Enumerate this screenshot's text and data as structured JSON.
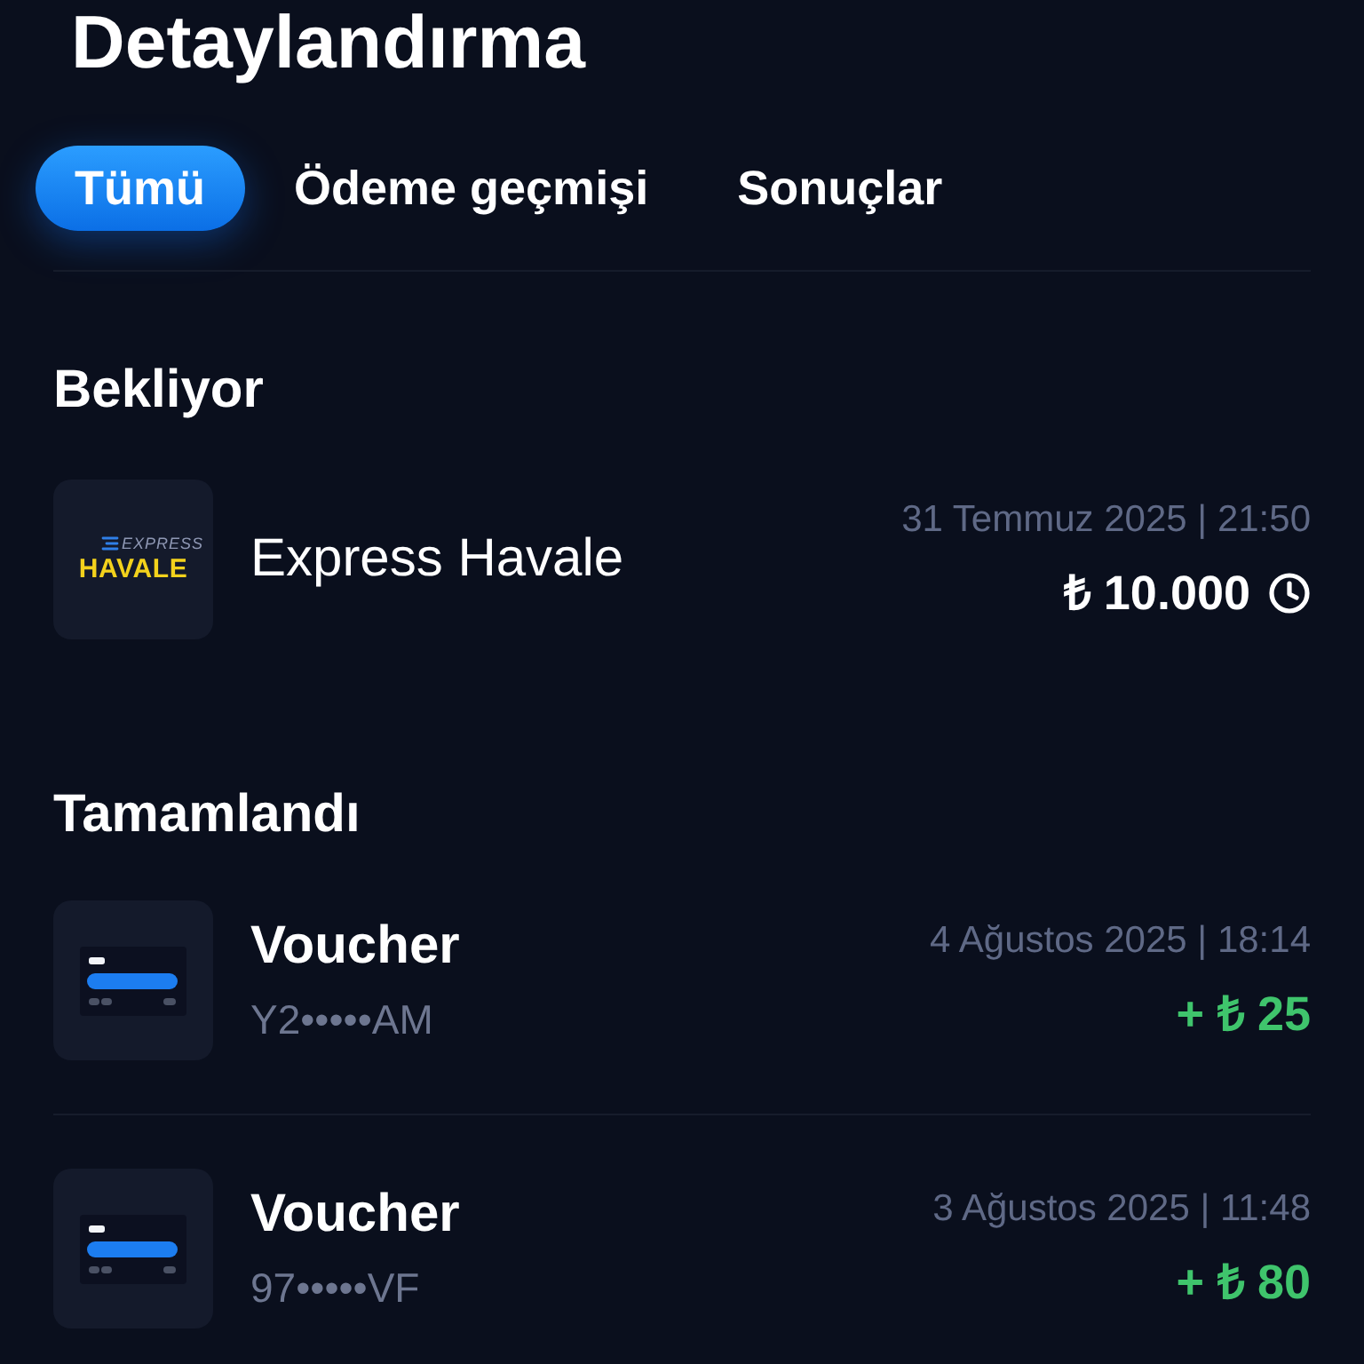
{
  "page": {
    "title": "Detaylandırma"
  },
  "tabs": [
    {
      "label": "Tümü",
      "selected": true
    },
    {
      "label": "Ödeme geçmişi",
      "selected": false
    },
    {
      "label": "Sonuçlar",
      "selected": false
    }
  ],
  "sections": [
    {
      "heading": "Bekliyor",
      "transactions": [
        {
          "kind": "express",
          "logo": {
            "top": "EXPRESS",
            "bottom": "HAVALE"
          },
          "name": "Express Havale",
          "date": "31 Temmuz 2025 | 21:50",
          "amount": "₺ 10.000",
          "pending": true
        }
      ]
    },
    {
      "heading": "Tamamlandı",
      "transactions": [
        {
          "kind": "voucher",
          "name": "Voucher",
          "code": "Y2•••••AM",
          "date": "4 Ağustos 2025 | 18:14",
          "amount": "+ ₺ 25",
          "pending": false
        },
        {
          "kind": "voucher",
          "name": "Voucher",
          "code": "97•••••VF",
          "date": "3 Ağustos 2025 | 11:48",
          "amount": "+ ₺ 80",
          "pending": false
        }
      ]
    }
  ]
}
